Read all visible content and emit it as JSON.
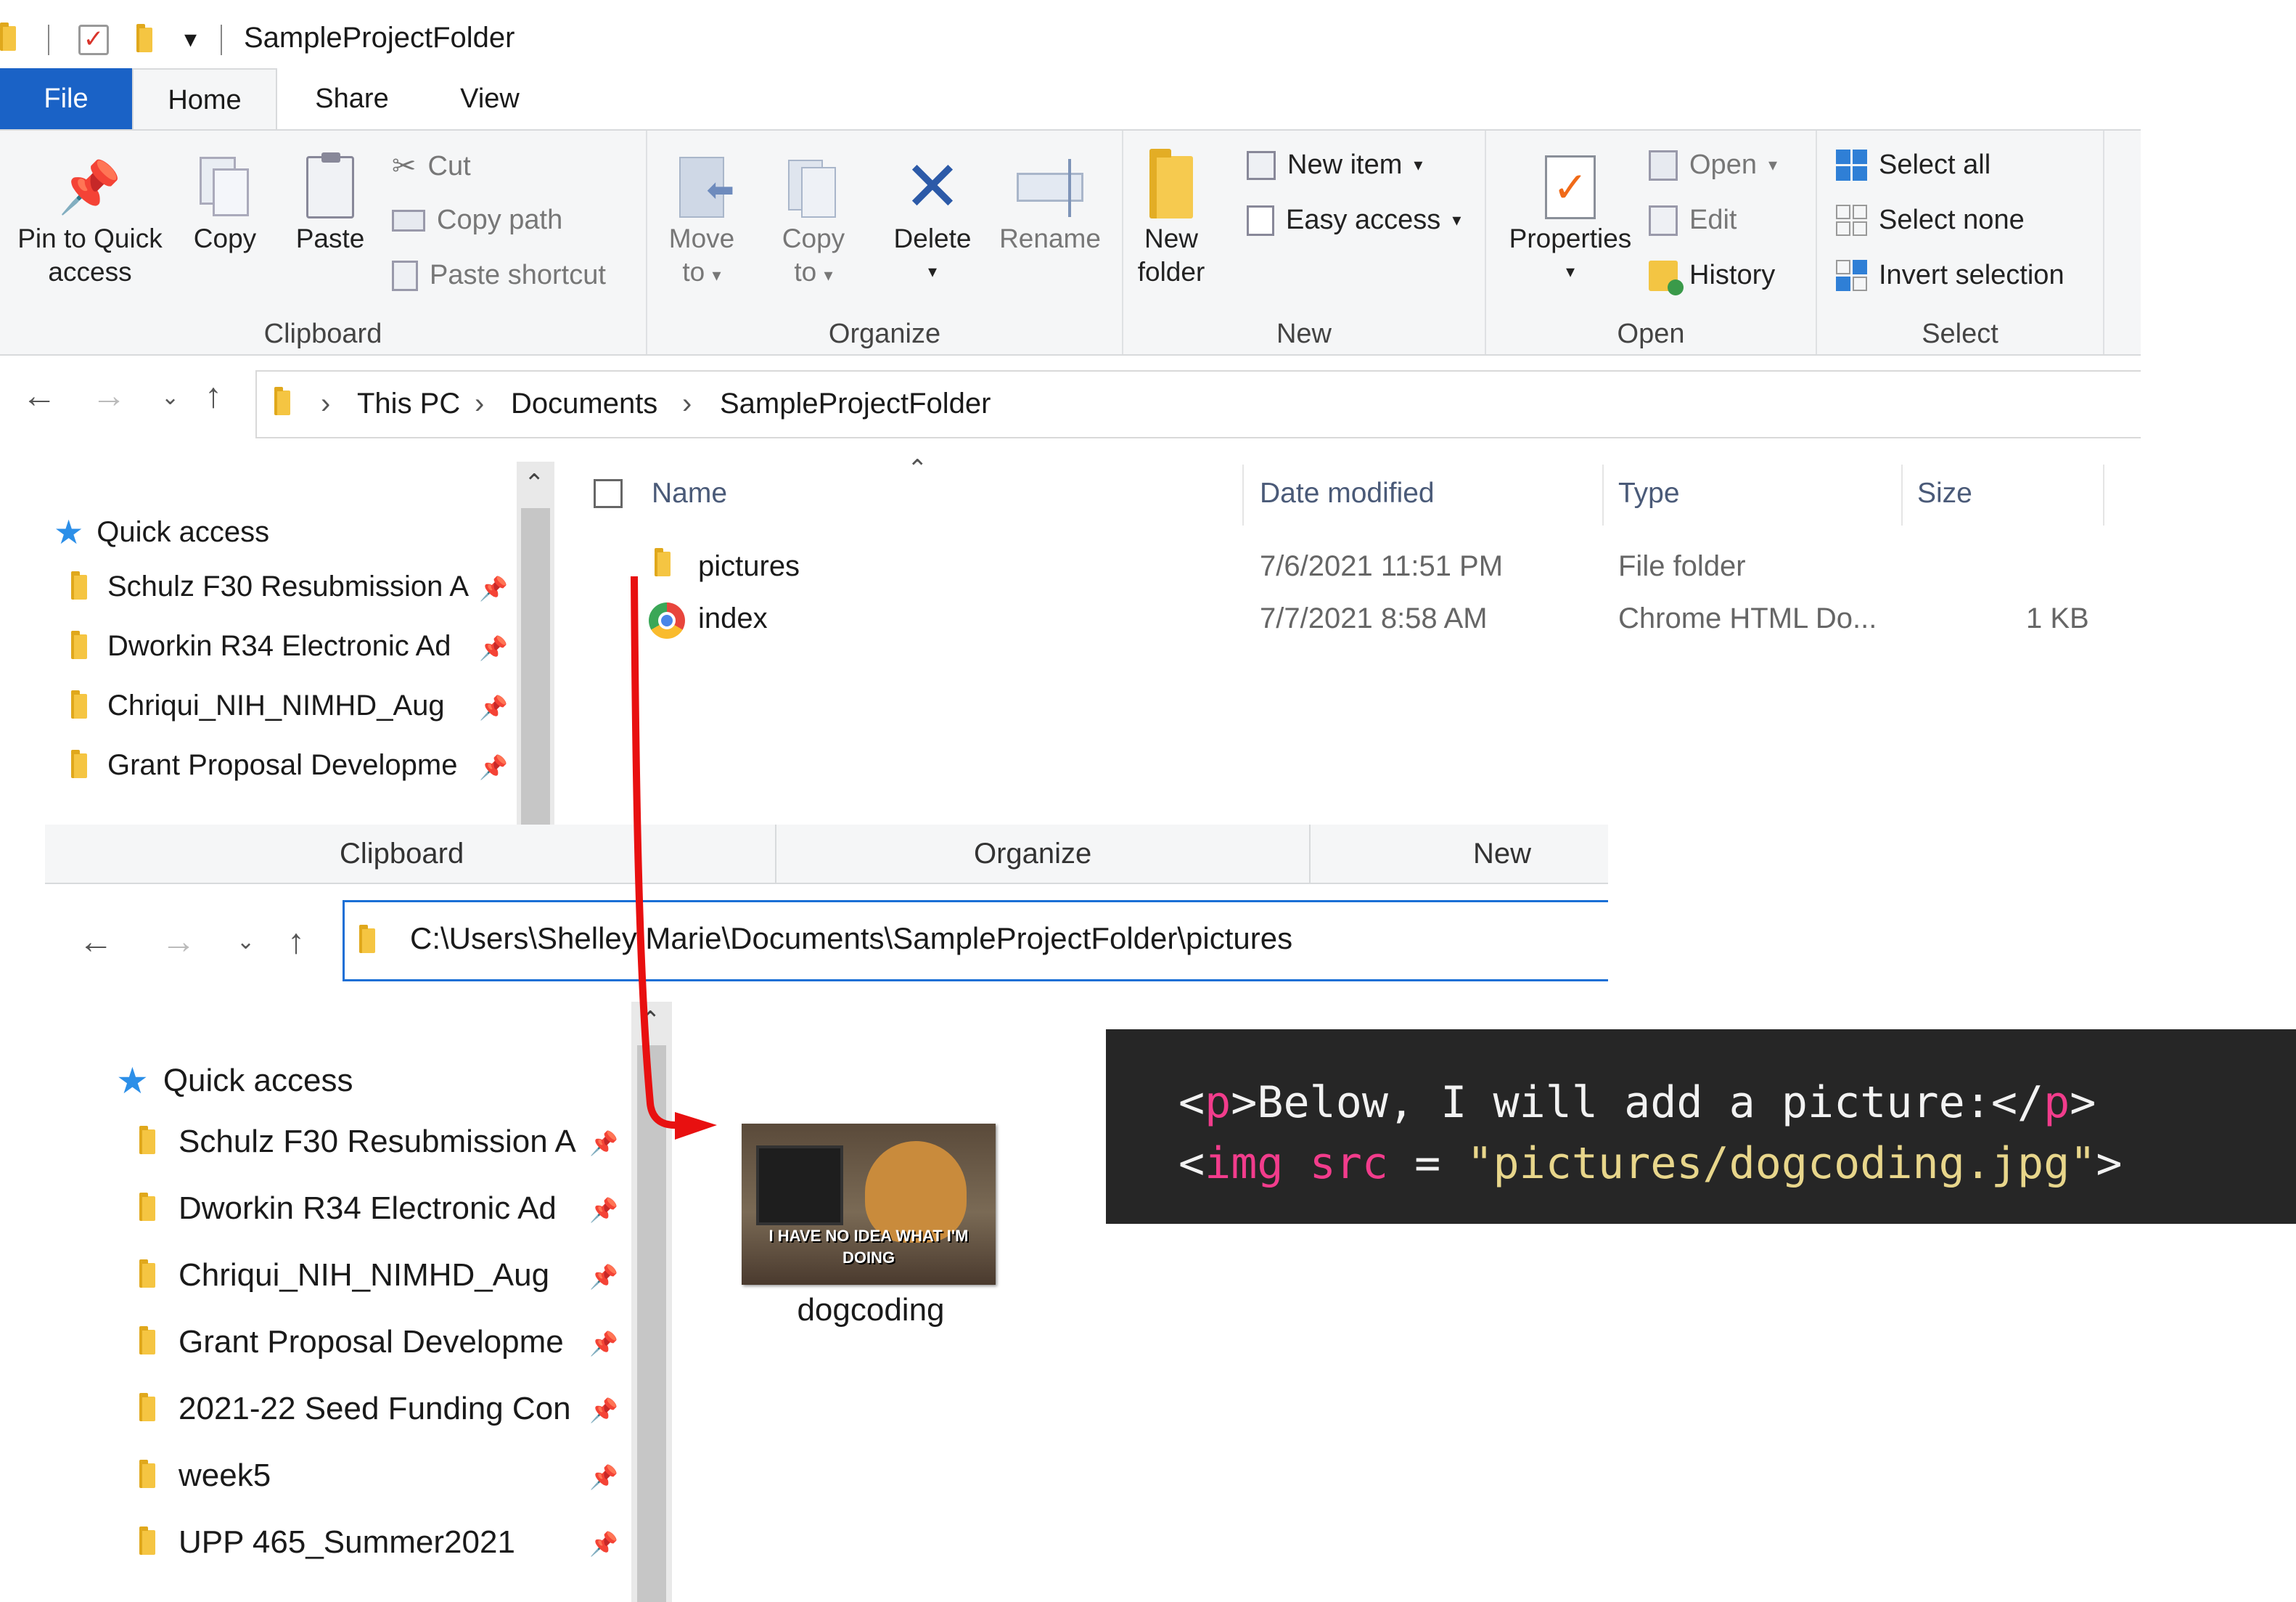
{
  "window1": {
    "title": "SampleProjectFolder",
    "tabs": [
      "File",
      "Home",
      "Share",
      "View"
    ],
    "ribbon": {
      "clipboard": {
        "label": "Clipboard",
        "pin_line1": "Pin to Quick",
        "pin_line2": "access",
        "copy": "Copy",
        "paste": "Paste",
        "cut": "Cut",
        "copy_path": "Copy path",
        "paste_shortcut": "Paste shortcut"
      },
      "organize": {
        "label": "Organize",
        "move_line1": "Move",
        "move_line2": "to",
        "copy_line1": "Copy",
        "copy_line2": "to",
        "delete": "Delete",
        "rename": "Rename"
      },
      "new": {
        "label": "New",
        "folder_line1": "New",
        "folder_line2": "folder",
        "new_item": "New item",
        "easy_access": "Easy access"
      },
      "open": {
        "label": "Open",
        "properties": "Properties",
        "open": "Open",
        "edit": "Edit",
        "history": "History"
      },
      "select": {
        "label": "Select",
        "select_all": "Select all",
        "select_none": "Select none",
        "invert": "Invert selection"
      }
    },
    "breadcrumb": [
      "This PC",
      "Documents",
      "SampleProjectFolder"
    ],
    "quick_access": "Quick access",
    "nav_items": [
      "Schulz F30 Resubmission A",
      "Dworkin R34 Electronic Ad",
      "Chriqui_NIH_NIMHD_Aug",
      "Grant Proposal Developme"
    ],
    "columns": {
      "name": "Name",
      "date": "Date modified",
      "type": "Type",
      "size": "Size"
    },
    "files": [
      {
        "name": "pictures",
        "date": "7/6/2021 11:51 PM",
        "type": "File folder",
        "size": ""
      },
      {
        "name": "index",
        "date": "7/7/2021 8:58 AM",
        "type": "Chrome HTML Do...",
        "size": "1 KB"
      }
    ]
  },
  "window2": {
    "group_labels": [
      "Clipboard",
      "Organize",
      "New"
    ],
    "address": "C:\\Users\\Shelley Marie\\Documents\\SampleProjectFolder\\pictures",
    "quick_access": "Quick access",
    "nav_items": [
      "Schulz F30 Resubmission A",
      "Dworkin R34 Electronic Ad",
      "Chriqui_NIH_NIMHD_Aug",
      "Grant Proposal Developme",
      "2021-22 Seed Funding Con",
      "week5",
      "UPP 465_Summer2021"
    ],
    "file": {
      "name": "dogcoding",
      "caption": "I HAVE NO IDEA WHAT I'M DOING"
    }
  },
  "code": {
    "line1": {
      "open": "<",
      "tag": "p",
      "text": ">Below, I will add a picture:</",
      "tag2": "p",
      "close": ">"
    },
    "line2": {
      "open": "<",
      "tag": "img src",
      "eq": " = ",
      "str": "\"pictures/dogcoding.jpg\"",
      "close": ">"
    }
  },
  "colors": {
    "accent": "#1a62c6",
    "arrow": "#e81010",
    "code_bg": "#262626",
    "code_tag": "#f23c8c",
    "code_string": "#e8d68b"
  }
}
